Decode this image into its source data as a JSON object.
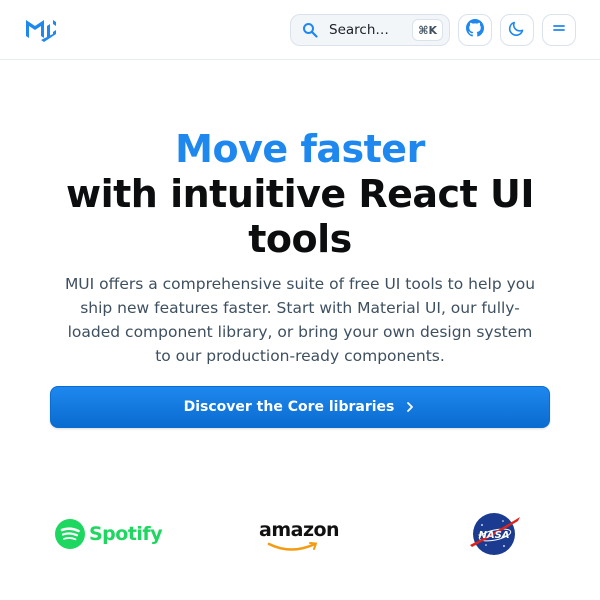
{
  "header": {
    "logo": "mui-logo-icon",
    "search": {
      "label": "Search…",
      "shortcut": "⌘K",
      "icon": "search-icon"
    },
    "buttons": {
      "github_icon": "github-icon",
      "theme_icon": "moon-icon",
      "menu_icon": "menu-icon"
    }
  },
  "hero": {
    "title_accent": "Move faster",
    "title_main": "with intuitive React UI tools",
    "description": "MUI offers a comprehensive suite of free UI tools to help you ship new features faster. Start with Material UI, our fully-loaded component library, or bring your own design system to our production-ready components.",
    "cta_label": "Discover the Core libraries",
    "cta_icon": "chevron-right-icon"
  },
  "logos": {
    "spotify": "Spotify",
    "amazon": "amazon",
    "nasa": "NASA"
  },
  "colors": {
    "accent": "#1e88ee",
    "button": "#0a6bd0",
    "spotify": "#1ed760",
    "nasa_blue": "#1a3b8f",
    "nasa_red": "#e2231a"
  }
}
